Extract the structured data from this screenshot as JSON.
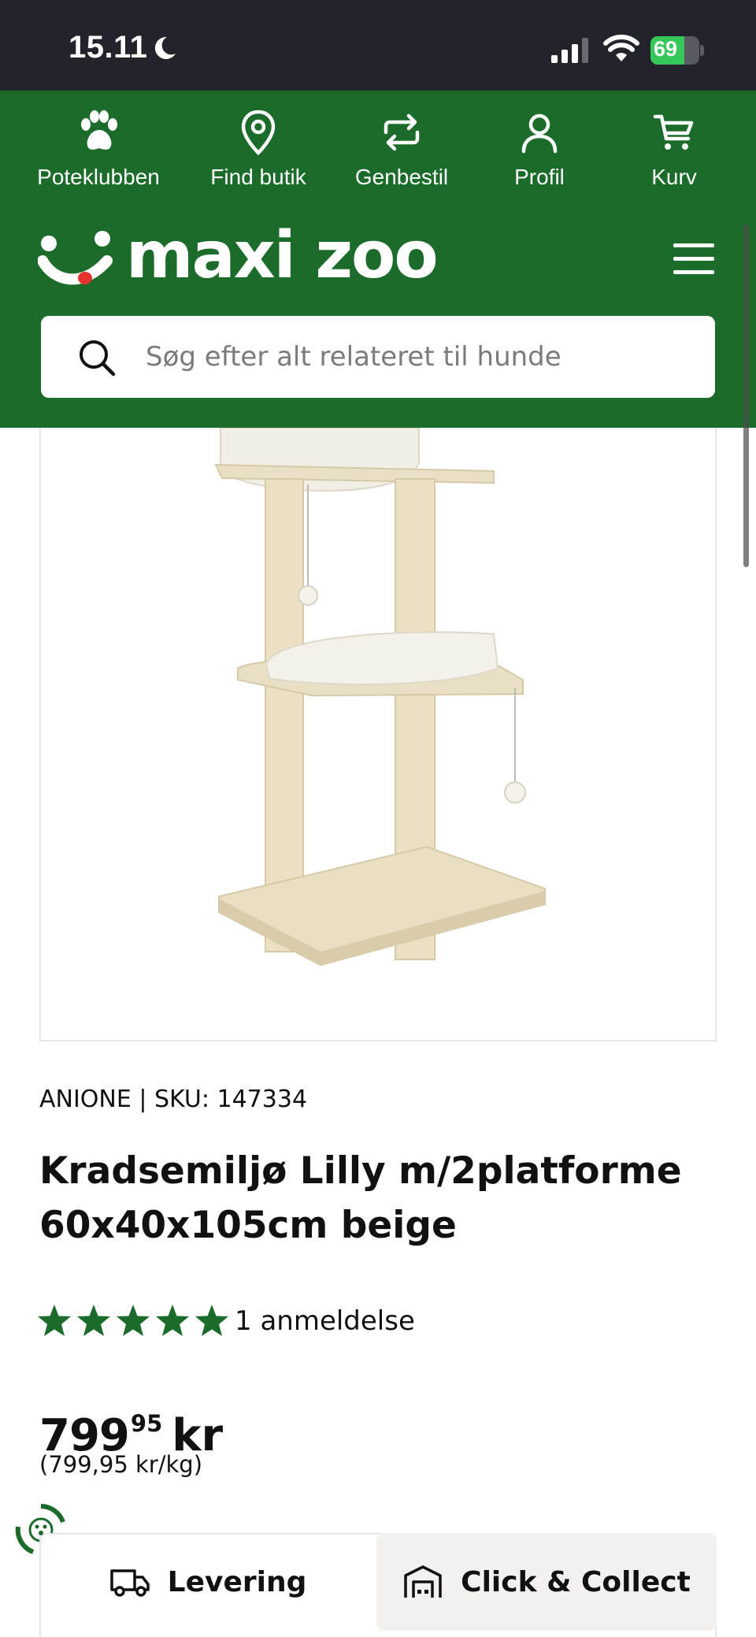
{
  "status_bar": {
    "time": "15.11",
    "battery": "69",
    "battery_level": 0.69
  },
  "top_nav": [
    {
      "label": "Poteklubben",
      "icon": "paw-icon"
    },
    {
      "label": "Find butik",
      "icon": "location-pin-icon"
    },
    {
      "label": "Genbestil",
      "icon": "reorder-icon"
    },
    {
      "label": "Profil",
      "icon": "user-icon"
    },
    {
      "label": "Kurv",
      "icon": "cart-icon"
    }
  ],
  "header": {
    "logo_text": "maxi zoo",
    "menu_icon": "hamburger-menu-icon"
  },
  "search": {
    "placeholder": "Søg efter alt relateret til hunde"
  },
  "product": {
    "brand_sku": "ANIONE | SKU: 147334",
    "title": "Kradsemiljø Lilly m/2platforme 60x40x105cm beige",
    "rating": 5,
    "review_count": "1 anmeldelse",
    "price_main": "799",
    "price_cents": "95",
    "price_currency": "kr",
    "unit_price": "(799,95 kr/kg)"
  },
  "delivery_tabs": {
    "delivery_label": "Levering",
    "collect_label": "Click & Collect"
  },
  "colors": {
    "brand_green": "#1b6b2b",
    "star_green": "#1b6b2b",
    "status_bar_bg": "#22232b"
  }
}
